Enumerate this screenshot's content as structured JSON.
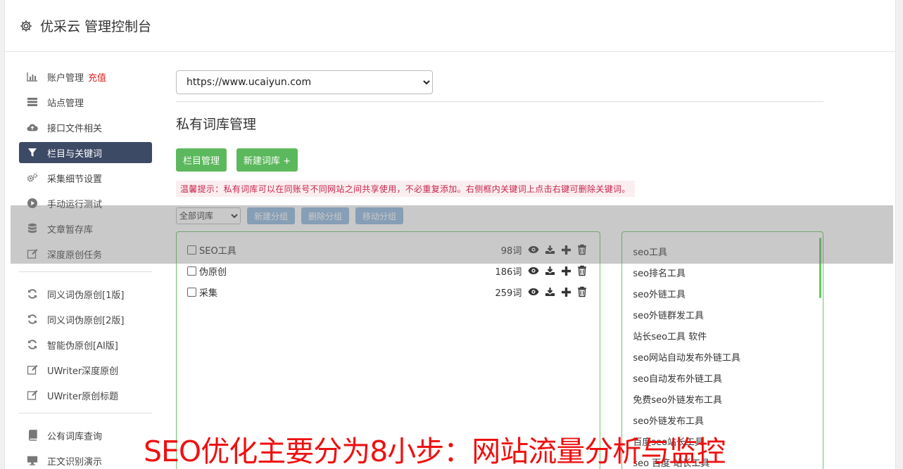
{
  "header": {
    "title": "优采云 管理控制台"
  },
  "sidebar": {
    "group1": [
      {
        "label": "账户管理",
        "extra": "充值",
        "icon": "bar-chart-icon"
      },
      {
        "label": "站点管理",
        "icon": "server-icon"
      },
      {
        "label": "接口文件相关",
        "icon": "cloud-upload-icon"
      },
      {
        "label": "栏目与关键词",
        "icon": "filter-icon",
        "active": true
      },
      {
        "label": "采集细节设置",
        "icon": "gears-icon"
      },
      {
        "label": "手动运行测试",
        "icon": "play-circle-icon"
      },
      {
        "label": "文章暂存库",
        "icon": "database-icon"
      },
      {
        "label": "深度原创任务",
        "icon": "edit-icon"
      }
    ],
    "group2": [
      {
        "label": "同义词伪原创[1版]",
        "icon": "refresh-icon"
      },
      {
        "label": "同义词伪原创[2版]",
        "icon": "refresh-icon"
      },
      {
        "label": "智能伪原创[AI版]",
        "icon": "refresh-icon"
      },
      {
        "label": "UWriter深度原创",
        "icon": "edit-icon"
      },
      {
        "label": "UWriter原创标题",
        "icon": "edit-icon"
      }
    ],
    "group3": [
      {
        "label": "公有词库查询",
        "icon": "book-icon"
      },
      {
        "label": "正文识别演示",
        "icon": "monitor-icon"
      }
    ]
  },
  "main": {
    "site_select": "https://www.ucaiyun.com",
    "section_title": "私有词库管理",
    "btn_columns": "栏目管理",
    "btn_new_library": "新建词库 +",
    "tip": "温馨提示：私有词库可以在同账号不同网站之间共享使用，不必重复添加。右侧框内关键词上点击右键可删除关键词。",
    "group_select": "全部词库",
    "btn_new_group": "新建分组",
    "btn_delete_group": "删除分组",
    "btn_move_group": "移动分组",
    "libraries": [
      {
        "name": "SEO工具",
        "count": "98词"
      },
      {
        "name": "伪原创",
        "count": "186词"
      },
      {
        "name": "采集",
        "count": "259词"
      }
    ],
    "keywords": [
      "seo工具",
      "seo排名工具",
      "seo外链工具",
      "seo外链群发工具",
      "站长seo工具 软件",
      "seo网站自动发布外链工具",
      "seo自动发布外链工具",
      "免费seo外链发布工具",
      "seo外链发布工具",
      "百度seo站长工具",
      "seo 百度 站长工具"
    ]
  },
  "caption": "SEO优化主要分为8小步：网站流量分析与监控",
  "colors": {
    "accent": "#5cb85c",
    "active_nav": "#3d4a66",
    "tip_text": "#c7254e",
    "caption": "#ee1111"
  }
}
